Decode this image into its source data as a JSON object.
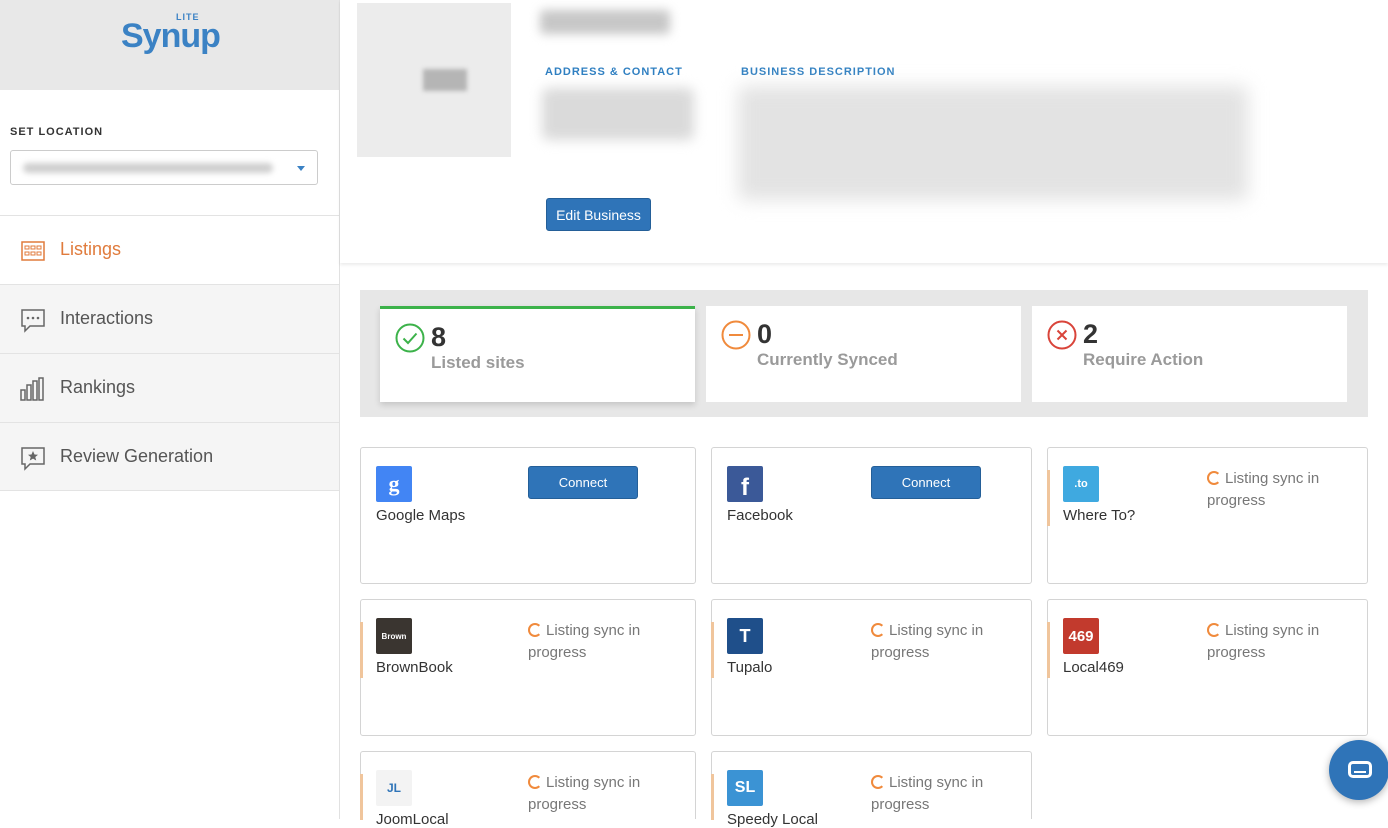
{
  "app": {
    "logo_text": "Synup",
    "logo_badge": "LITE"
  },
  "sidebar": {
    "set_location_label": "SET LOCATION",
    "nav": [
      {
        "label": "Listings",
        "icon": "listings-grid-icon",
        "active": true
      },
      {
        "label": "Interactions",
        "icon": "chat-dots-icon",
        "active": false
      },
      {
        "label": "Rankings",
        "icon": "bar-chart-icon",
        "active": false
      },
      {
        "label": "Review Generation",
        "icon": "star-chat-icon",
        "active": false
      }
    ]
  },
  "business": {
    "address_title": "ADDRESS & CONTACT",
    "description_title": "BUSINESS DESCRIPTION",
    "edit_button": "Edit Business"
  },
  "stats": [
    {
      "value": "8",
      "label": "Listed sites",
      "icon": "check-circle-icon",
      "color": "#3cb24a"
    },
    {
      "value": "0",
      "label": "Currently Synced",
      "icon": "minus-circle-icon",
      "color": "#f08a3c"
    },
    {
      "value": "2",
      "label": "Require Action",
      "icon": "x-circle-icon",
      "color": "#d9443a"
    }
  ],
  "listings": [
    {
      "name": "Google Maps",
      "logo_text": "g",
      "logo_color": "#4285f4",
      "action": "Connect"
    },
    {
      "name": "Facebook",
      "logo_text": "f",
      "logo_color": "#3b5998",
      "action": "Connect"
    },
    {
      "name": "Where To?",
      "logo_text": ".to",
      "logo_color": "#3fa9e0",
      "status": "Listing sync in progress"
    },
    {
      "name": "BrownBook",
      "logo_text": "Brown",
      "logo_color": "#3a3530",
      "status": "Listing sync in progress"
    },
    {
      "name": "Tupalo",
      "logo_text": "T",
      "logo_color": "#1f4f8a",
      "status": "Listing sync in progress"
    },
    {
      "name": "Local469",
      "logo_text": "469",
      "logo_color": "#c23a2d",
      "status": "Listing sync in progress"
    },
    {
      "name": "JoomLocal",
      "logo_text": "JL",
      "logo_color": "#f3f3f3",
      "status": "Listing sync in progress"
    },
    {
      "name": "Speedy Local",
      "logo_text": "SL",
      "logo_color": "#3b93d4",
      "status": "Listing sync in progress"
    }
  ]
}
